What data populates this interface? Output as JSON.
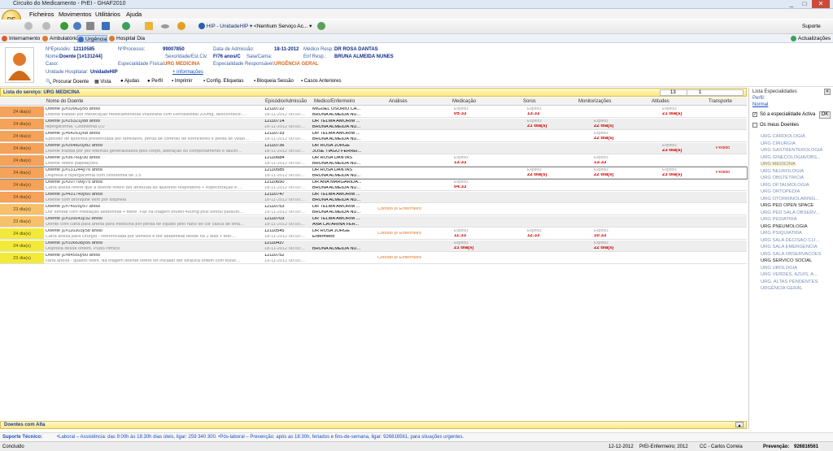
{
  "window": {
    "title": "Circuito do Medicamento - PrEI - GHAF2010",
    "min": "_",
    "max": "□",
    "close": "✕"
  },
  "menu": [
    "Ficheiros",
    "Movimentos",
    "Utilitários",
    "Ajuda"
  ],
  "toolbar": {
    "hospital": "HIP - UnidadeHIP",
    "servico": "<Nenhum Serviço Ac...",
    "suporte": "Suporte"
  },
  "tabs": {
    "internamento": "Internamento",
    "ambulatorio": "Ambulatório",
    "urgencia": "Urgência",
    "hospital_dia": "Hospital Dia",
    "actualizacoes": "Actualizações"
  },
  "patient": {
    "episodio_lbl": "NºEpisódio:",
    "episodio": "12110585",
    "processo_lbl": "NºProcesso:",
    "processo": "99007850",
    "admissao_lbl": "Data de Admissão:",
    "admissao": "18-11-2012",
    "medico_lbl": "Médico Resp.:",
    "medico": "DR ROSA DANTAS",
    "nome_lbl": "Nome:",
    "nome": "Doente [1#131244]",
    "sexo_lbl": "Sexo/Idade/Est.Civ:",
    "sexo": "F/76 anos/C",
    "sala_lbl": "Sala/Cama:",
    "sala": "",
    "enf_lbl": "Enf Resp.:",
    "enf": "BRUNA ALMEIDA NUNES",
    "caso_lbl": "Caso:",
    "caso": "",
    "esp_fisica_lbl": "Especialidade Física:",
    "esp_fisica": "URG MEDICINA",
    "esp_resp_lbl": "Especialidade Responsável:",
    "esp_resp": "URGÊNCIA GERAL",
    "unidade_lbl": "Unidade Hospitalar:",
    "unidade": "UnidadeHIP",
    "mais": "+ informações"
  },
  "actions": [
    "Procurar Doente",
    "Vista",
    "Ajudas",
    "Perfil",
    "Imprimir",
    "Config. Etiquetas",
    "Bloqueia Sessão",
    "Casos Anteriores"
  ],
  "list": {
    "title": "Lista do serviço: URG MEDICINA",
    "count1": "13",
    "count2": "1"
  },
  "columns": [
    "Nome do Doente",
    "Episódio/Admissão",
    "Medico/Enfermeiro",
    "Análises",
    "Medicação",
    "Soros",
    "Monitorizações",
    "Atitudes",
    "Transporte"
  ],
  "rows": [
    {
      "age": "24 dia(s)",
      "color": "#f5a25a",
      "name": "Doente [1#10962]/55 anos/",
      "desc": "Doente tratado por intoxicação medicamentosa voluntária com Fenobarbital 200mg, desconhece-…",
      "ep": "12110722",
      "date": "18-11-2012 00:00:...",
      "med": "MIGUEL OSORIO CA...",
      "enf": "BRUNA ALMEIDA NU...",
      "an": "",
      "medic": "05:33",
      "soros": "13:33",
      "mon": "",
      "ati": "21 dia(s)",
      "tr": ""
    },
    {
      "age": "24 dia(s)",
      "color": "#f5a25a",
      "name": "Doente [1#25321]/88 anos/",
      "desc": "hiperglicemia. Cetonémia 0,0",
      "ep": "12110714",
      "date": "18-11-2012 00:00:...",
      "med": "DR TELMA AMORIM ...",
      "enf": "BRUNA ALMEIDA NU...",
      "an": "",
      "medic": "",
      "soros": "21 dia(s)",
      "mon": "22 dia(s)",
      "ati": "",
      "tr": ""
    },
    {
      "age": "24 dia(s)",
      "color": "#f5a25a",
      "name": "Doente [1#64261]/68 anos/",
      "desc": "Episódio de lipotímia presenciada por familiares, perda de controlo de esfíncteres e perda de visão…",
      "ep": "12110733",
      "date": "18-11-2012 00:00:...",
      "med": "DR TELMA AMORIM ...",
      "enf": "BRUNA ALMEIDA NU...",
      "an": "",
      "medic": "",
      "soros": "",
      "mon": "22 dia(s)",
      "ati": "",
      "tr": ""
    },
    {
      "age": "24 dia(s)",
      "color": "#f5a25a",
      "name": "Doente [1#264820]/82 anos/",
      "desc": "Doente trazida por por edemas generalizados pelo corpo, alteração do comportamento e alucin…",
      "ep": "12110736",
      "date": "18-11-2012 00:00:...",
      "med": "DR ROSA JORGE",
      "enf": "JOSE TIAGO FERREI...",
      "an": "",
      "medic": "",
      "soros": "",
      "mon": "",
      "ati": "23 dia(s)",
      "tr": "Pedido"
    },
    {
      "age": "24 dia(s)",
      "color": "#f5a25a",
      "name": "Doente [1#36760]/30 anos/",
      "desc": "Doente refere palpitações.",
      "ep": "12110684",
      "date": "18-11-2012 00:00:...",
      "med": "DR ROSA DANTAS",
      "enf": "BRUNA ALMEIDA NU...",
      "an": "",
      "medic": "13:33",
      "soros": "",
      "mon": "13:33",
      "ati": "",
      "tr": ""
    },
    {
      "age": "24 dia(s)",
      "color": "#f5a25a",
      "name": "Doente [1#131244]/76 anos/",
      "desc": "Dispneia e hiperglicemia com cetonémia de 1.5",
      "ep": "12110585",
      "date": "18-11-2012 00:00:...",
      "med": "DR ROSA DANTAS",
      "enf": "BRUNA ALMEIDA NU...",
      "an": "",
      "medic": "",
      "soros": "22 dia(s)",
      "mon": "22 dia(s)",
      "ati": "23 dia(s)",
      "tr": "Pedido"
    },
    {
      "age": "24 dia(s)",
      "color": "#f5a25a",
      "name": "Doente [1#207799]/75 anos/",
      "desc": "Carta anexa refere que a doente refere dor atribuída ao aparelho respiratório + expectoração e …",
      "ep": "12110650",
      "date": "18-11-2012 00:00:...",
      "med": "DR ANA MARGARIDA...",
      "enf": "BRUNA ALMEIDA NU...",
      "an": "",
      "medic": "04:33",
      "soros": "",
      "mon": "",
      "ati": "",
      "tr": ""
    },
    {
      "age": "24 dia(s)",
      "color": "#f5a25a",
      "name": "Doente [1#431749]/60 anos/",
      "desc": "Doente com bronquite vem por dispneia",
      "ep": "12110747",
      "date": "18-11-2012 00:00:...",
      "med": "DR TELMA AMORIM ...",
      "enf": "BRUNA ALMEIDA NU...",
      "an": "",
      "medic": "",
      "soros": "",
      "mon": "",
      "ati": "",
      "tr": ""
    },
    {
      "age": "23 dia(s)",
      "color": "#f7c06a",
      "name": "Doente [1#74925]/57 anos/",
      "desc": "Dor lombar com irradiação abdominal + febre. Faz na triagem brufen 400mg pois tomou paracet…",
      "ep": "12110753",
      "date": "19-11-2012 00:00:...",
      "med": "DR TELMA AMORIM ...",
      "enf": "BRUNA ALMEIDA NU...",
      "an": "Colhido p/ Enfermeiro",
      "medic": "",
      "soros": "",
      "mon": "",
      "ati": "",
      "tr": ""
    },
    {
      "age": "23 dia(s)",
      "color": "#f7c06a",
      "name": "Doente [1#116643]/32 anos/",
      "desc": "Utente com carta para anexa para medicina por perda de líquido pelo nariz de cor casca de limã…",
      "ep": "12110703",
      "date": "18-11-2012 00:00:...",
      "med": "DR TELMA AMORIM ...",
      "enf": "ANA CATARINA FER...",
      "an": "",
      "medic": "",
      "soros": "",
      "mon": "",
      "ati": "",
      "tr": ""
    },
    {
      "age": "24 dia(s)",
      "color": "#f2ea3a",
      "name": "Doente [1#116303]/58 anos/",
      "desc": "Carta anexa para cirurgia - referenciada por vómitos e dor abdominal desde há 2 dias + febr…",
      "ep": "12110545",
      "date": "18-11-2012 00:00:...",
      "med": "DR ROSA JORGE",
      "enf": "Enfermeiro",
      "an": "Colhido p/ Enfermeiro",
      "medic": "11:33",
      "soros": "12:33",
      "mon": "10:33",
      "ati": "",
      "tr": ""
    },
    {
      "age": "24 dia(s)",
      "color": "#f2ea3a",
      "name": "Doente [1#106638]/56 anos/",
      "desc": "Dispneia desde ontem. Pulso rítmico",
      "ep": "12110437",
      "date": "18-11-2012 00:00:...",
      "med": "",
      "enf": "BRUNA ALMEIDA NU...",
      "an": "",
      "medic": "21 dia(s)",
      "soros": "",
      "mon": "22 dia(s)",
      "ati": "",
      "tr": ""
    },
    {
      "age": "23 dia(s)",
      "color": "#f2ea3a",
      "name": "Doente [1#84550]/60 anos/",
      "desc": "carta anexa - quadro febril. Na triagem doente refere ter iniciado dor torácica ontem com tosse…",
      "ep": "12110752",
      "date": "19-11-2012 00:00:...",
      "med": "",
      "enf": "",
      "an": "Colhido p/ Enfermeiro",
      "medic": "",
      "soros": "",
      "mon": "",
      "ati": "",
      "tr": ""
    }
  ],
  "expirou": "Expirou:",
  "right": {
    "title": "Lista Especialidades",
    "perfil_lbl": "Perfil:",
    "perfil": "Normal",
    "so_activa": "Só a especialidade Activa",
    "ok": "OK",
    "meus": "Os meus Doentes",
    "items": [
      "URG CARDIOLOGIA",
      "URG CIRURGIA",
      "URG GASTRENTEROLOGIA",
      "URG GINECOLOGIA/OBS...",
      "URG MEDICINA",
      "URG NEUROLOGIA",
      "URG OBSTETRICIA",
      "URG OFTALMOLOGIA",
      "URG ORTOPEDIA",
      "URG OTORRINOLARING...",
      "URG PED OPEN SPACE",
      "URG PED SALA OBSERV...",
      "URG PEDIATRIA",
      "URG PNEUMOLOGIA",
      "URG PSIQUIATRIA",
      "URG SALA DECISAO CLI...",
      "URG SALA EMERGENCIA",
      "URG SALA OBSERVACOES",
      "URG SERVICO SOCIAL",
      "URG UROLOGIA",
      "URG VERDES, AZUIS, A...",
      "URG. ALTAS PENDENTES",
      "URGÊNCIA GERAL"
    ]
  },
  "alta": "Doentes com Alta",
  "suporte": {
    "lbl": "Suporte Técnico:",
    "text": "•Laboral – Assistência: das 9:00h às 18:30h dias úteis, ligar: 259 340 300. •Pós-laboral – Prevenção: após as 18:30h, feriados e fins-de-semana, ligar: 926816561, para situações urgentes."
  },
  "status": {
    "left": "Concluido",
    "date": "12-12-2012",
    "role": "PrEI-Enfermeiro; 2012",
    "user": "CC - Carlos Correia",
    "prev_lbl": "Prevenção:",
    "prev": "926816561"
  }
}
